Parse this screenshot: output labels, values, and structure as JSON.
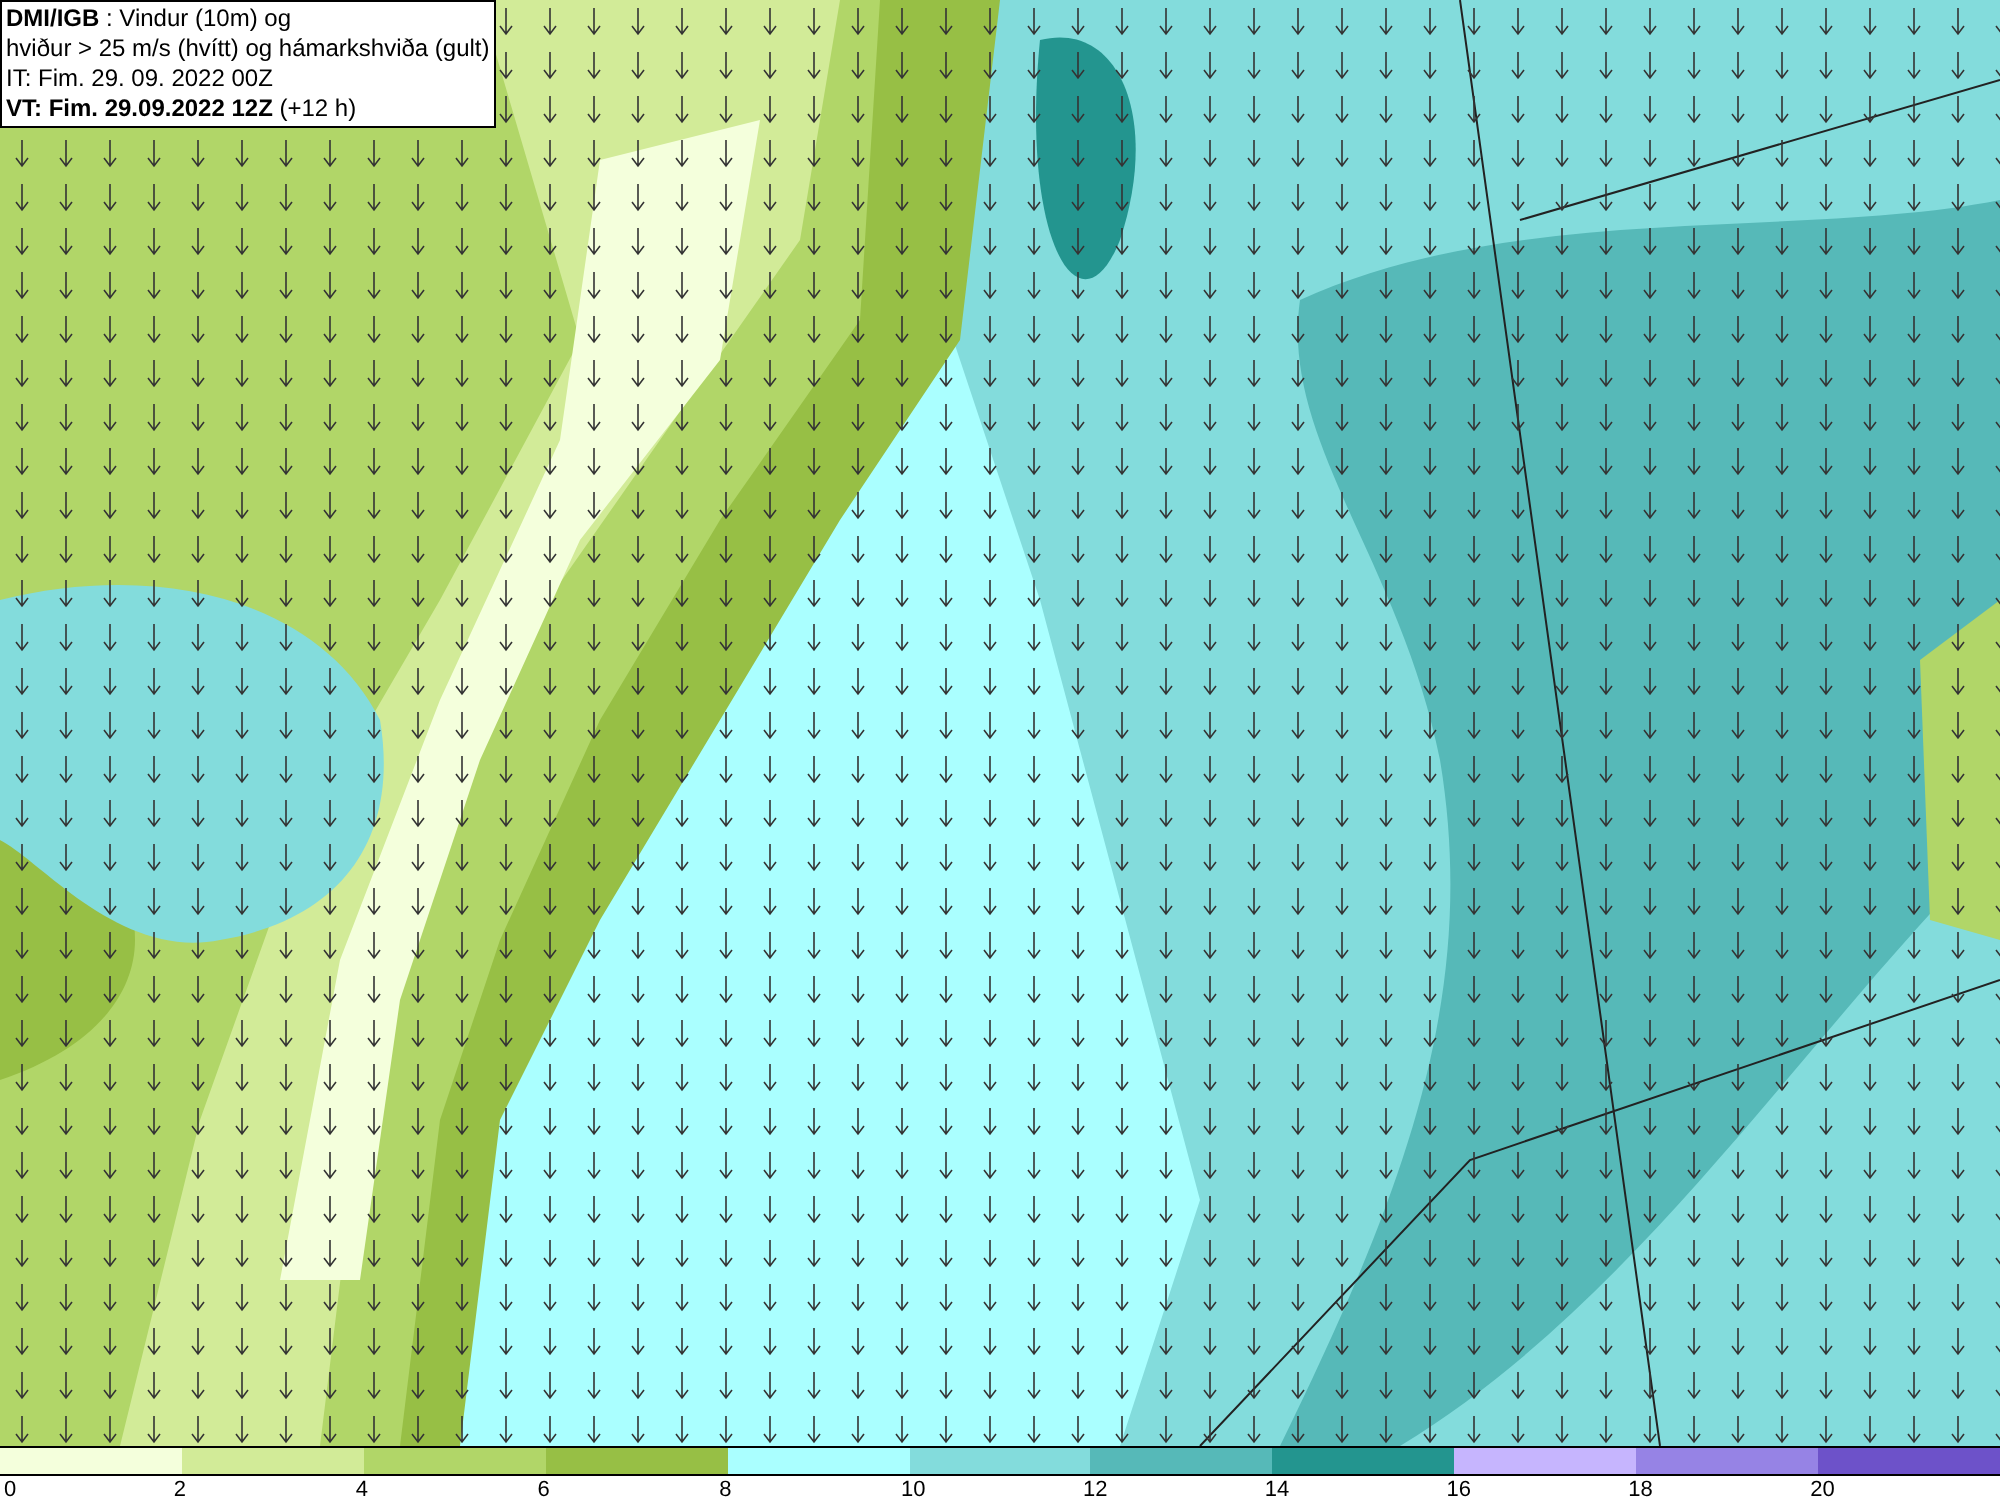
{
  "header": {
    "lines": [
      "**DMI/IGB** : Vindur (10m) og",
      "hviður > 25 m/s (hvítt) og hámarkshviða (gult)",
      "IT: Fim. 29. 09. 2022 00Z",
      "**VT: Fim. 29.09.2022 12Z** (+12 h)"
    ]
  },
  "legend": {
    "segments": [
      {
        "color": "#f4ffdc"
      },
      {
        "color": "#d2eb98"
      },
      {
        "color": "#b1d668"
      },
      {
        "color": "#97bf45"
      },
      {
        "color": "#aaffff"
      },
      {
        "color": "#83dcdc"
      },
      {
        "color": "#56b9b8"
      },
      {
        "color": "#23958f"
      },
      {
        "color": "#c6b5fe"
      },
      {
        "color": "#9683e5"
      },
      {
        "color": "#6d52c9"
      }
    ],
    "ticks": [
      "0",
      "2",
      "4",
      "6",
      "8",
      "10",
      "12",
      "14",
      "16",
      "18",
      "20"
    ]
  }
}
